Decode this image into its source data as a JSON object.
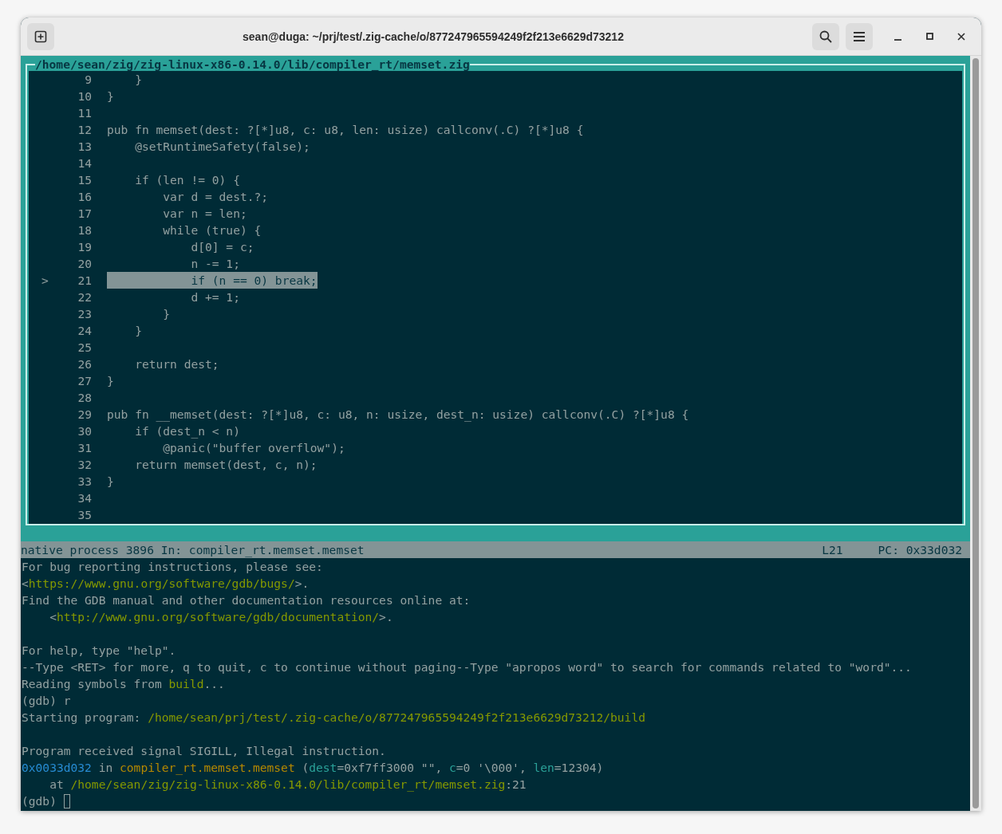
{
  "window": {
    "title": "sean@duga: ~/prj/test/.zig-cache/o/877247965594249f2f213e6629d73212"
  },
  "source": {
    "file": "/home/sean/zig/zig-linux-x86-0.14.0/lib/compiler_rt/memset.zig",
    "lines": [
      {
        "number": "9",
        "code": "    }",
        "current": false
      },
      {
        "number": "10",
        "code": "}",
        "current": false
      },
      {
        "number": "11",
        "current": false
      },
      {
        "number": "12",
        "code": "pub fn memset(dest: ?[*]u8, c: u8, len: usize) callconv(.C) ?[*]u8 {",
        "current": false
      },
      {
        "number": "13",
        "code": "    @setRuntimeSafety(false);",
        "current": false
      },
      {
        "number": "14",
        "current": false
      },
      {
        "number": "15",
        "code": "    if (len != 0) {",
        "current": false
      },
      {
        "number": "16",
        "code": "        var d = dest.?;",
        "current": false
      },
      {
        "number": "17",
        "code": "        var n = len;",
        "current": false
      },
      {
        "number": "18",
        "code": "        while (true) {",
        "current": false
      },
      {
        "number": "19",
        "code": "            d[0] = c;",
        "current": false
      },
      {
        "number": "20",
        "code": "            n -= 1;",
        "current": false
      },
      {
        "number": "21",
        "code": "            if (n == 0) break;",
        "current": true,
        "marker": ">"
      },
      {
        "number": "22",
        "code": "            d += 1;",
        "current": false
      },
      {
        "number": "23",
        "code": "        }",
        "current": false
      },
      {
        "number": "24",
        "code": "    }",
        "current": false
      },
      {
        "number": "25",
        "current": false
      },
      {
        "number": "26",
        "code": "    return dest;",
        "current": false
      },
      {
        "number": "27",
        "code": "}",
        "current": false
      },
      {
        "number": "28",
        "current": false
      },
      {
        "number": "29",
        "code": "pub fn __memset(dest: ?[*]u8, c: u8, n: usize, dest_n: usize) callconv(.C) ?[*]u8 {",
        "current": false
      },
      {
        "number": "30",
        "code": "    if (dest_n < n)",
        "current": false
      },
      {
        "number": "31",
        "code": "        @panic(\"buffer overflow\");",
        "current": false
      },
      {
        "number": "32",
        "code": "    return memset(dest, c, n);",
        "current": false
      },
      {
        "number": "33",
        "code": "}",
        "current": false
      },
      {
        "number": "34",
        "current": false
      },
      {
        "number": "35",
        "current": false
      }
    ]
  },
  "status_bar": {
    "process": "native process 3896 In: compiler_rt.memset.memset",
    "line": "L21",
    "pc": "PC: 0x33d032"
  },
  "console": {
    "lines": [
      {
        "kind": "text",
        "segments": [
          {
            "text": "For bug reporting instructions, please see:",
            "kind": "plain"
          }
        ]
      },
      {
        "kind": "text",
        "segments": [
          {
            "text": "<",
            "kind": "plain"
          },
          {
            "text": "https://www.gnu.org/software/gdb/bugs/",
            "kind": "path"
          },
          {
            "text": ">.",
            "kind": "plain"
          }
        ]
      },
      {
        "kind": "text",
        "segments": [
          {
            "text": "Find the GDB manual and other documentation resources online at:",
            "kind": "plain"
          }
        ]
      },
      {
        "kind": "text",
        "segments": [
          {
            "text": "    <",
            "kind": "plain"
          },
          {
            "text": "http://www.gnu.org/software/gdb/documentation/",
            "kind": "path"
          },
          {
            "text": ">.",
            "kind": "plain"
          }
        ]
      },
      {
        "kind": "blank"
      },
      {
        "kind": "text",
        "segments": [
          {
            "text": "For help, type \"help\".",
            "kind": "plain"
          }
        ]
      },
      {
        "kind": "text",
        "segments": [
          {
            "text": "--Type <RET> for more, q to quit, c to continue without paging--Type \"apropos word\" to search for commands related to \"word\"...",
            "kind": "plain"
          }
        ]
      },
      {
        "kind": "text",
        "segments": [
          {
            "text": "Reading symbols from ",
            "kind": "plain"
          },
          {
            "text": "build",
            "kind": "path"
          },
          {
            "text": "...",
            "kind": "plain"
          }
        ]
      },
      {
        "kind": "text",
        "segments": [
          {
            "text": "(gdb) r",
            "kind": "plain"
          }
        ]
      },
      {
        "kind": "text",
        "segments": [
          {
            "text": "Starting program: ",
            "kind": "plain"
          },
          {
            "text": "/home/sean/prj/test/.zig-cache/o/877247965594249f2f213e6629d73212/build",
            "kind": "path"
          }
        ]
      },
      {
        "kind": "blank"
      },
      {
        "kind": "text",
        "segments": [
          {
            "text": "Program received signal SIGILL, Illegal instruction.",
            "kind": "plain"
          }
        ]
      },
      {
        "kind": "text",
        "segments": [
          {
            "text": "0x0033d032",
            "kind": "address"
          },
          {
            "text": " in ",
            "kind": "plain"
          },
          {
            "text": "compiler_rt.memset.memset",
            "kind": "function"
          },
          {
            "text": " (",
            "kind": "plain"
          },
          {
            "text": "dest",
            "kind": "argument"
          },
          {
            "text": "=0xf7ff3000 \"\", ",
            "kind": "plain"
          },
          {
            "text": "c",
            "kind": "argument"
          },
          {
            "text": "=0 '\\000', ",
            "kind": "plain"
          },
          {
            "text": "len",
            "kind": "argument"
          },
          {
            "text": "=12304)",
            "kind": "plain"
          }
        ]
      },
      {
        "kind": "text",
        "segments": [
          {
            "text": "    at ",
            "kind": "plain"
          },
          {
            "text": "/home/sean/zig/zig-linux-x86-0.14.0/lib/compiler_rt/memset.zig",
            "kind": "path"
          },
          {
            "text": ":21",
            "kind": "plain"
          }
        ]
      },
      {
        "kind": "text",
        "cursor": true,
        "segments": [
          {
            "text": "(gdb) ",
            "kind": "plain"
          }
        ]
      }
    ]
  }
}
